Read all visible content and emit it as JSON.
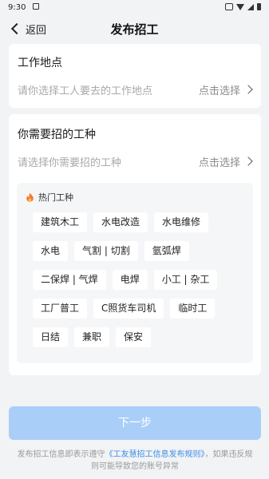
{
  "status_bar": {
    "time": "9:30"
  },
  "nav": {
    "back_label": "返回",
    "title": "发布招工"
  },
  "location": {
    "heading": "工作地点",
    "placeholder": "请你选择工人要去的工作地点",
    "action": "点击选择"
  },
  "job_type": {
    "heading": "你需要招的工种",
    "placeholder": "请选择你需要招的工种",
    "action": "点击选择",
    "hot_title": "热门工种",
    "tag_rows": [
      [
        "建筑木工",
        "水电改造",
        "水电维修"
      ],
      [
        "水电",
        "气割 | 切割",
        "氩弧焊"
      ],
      [
        "二保焊 | 气焊",
        "电焊",
        "小工 | 杂工"
      ],
      [
        "工厂普工",
        "C照货车司机",
        "临时工"
      ],
      [
        "日结",
        "兼职",
        "保安"
      ]
    ]
  },
  "next_button": "下一步",
  "footer": {
    "prefix": "发布招工信息即表示遵守",
    "link": "《工友慧招工信息发布规则》",
    "suffix": "，如果违反规则可能导致您的账号异常"
  },
  "colors": {
    "primary_disabled": "#a9cff9",
    "link": "#3b8de6",
    "fire": "#f57a2a"
  }
}
